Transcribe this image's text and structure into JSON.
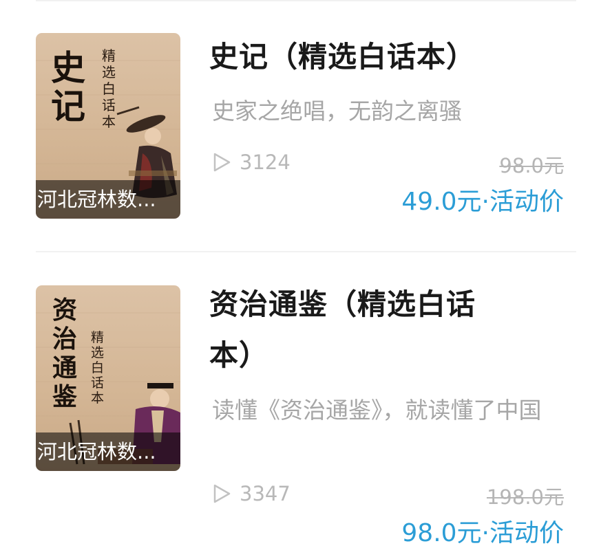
{
  "items": [
    {
      "cover_title": "史记",
      "cover_subtitle": "精选白话本",
      "publisher": "河北冠林数...",
      "title": "史记（精选白话本）",
      "subtitle": "史家之绝唱，无韵之离骚",
      "plays": "3124",
      "original_price": "98.0元",
      "price_label": "49.0元·活动价",
      "icon": "play-icon"
    },
    {
      "cover_title": "资治通鉴",
      "cover_subtitle": "精选白话本",
      "publisher": "河北冠林数...",
      "title": "资治通鉴（精选白话本）",
      "subtitle": "读懂《资治通鉴》，就读懂了中国",
      "plays": "3347",
      "original_price": "198.0元",
      "price_label": "98.0元·活动价",
      "icon": "play-icon"
    }
  ],
  "colors": {
    "price": "#2b9dd6",
    "muted": "#a6a6a6",
    "title": "#1a1a1a"
  }
}
